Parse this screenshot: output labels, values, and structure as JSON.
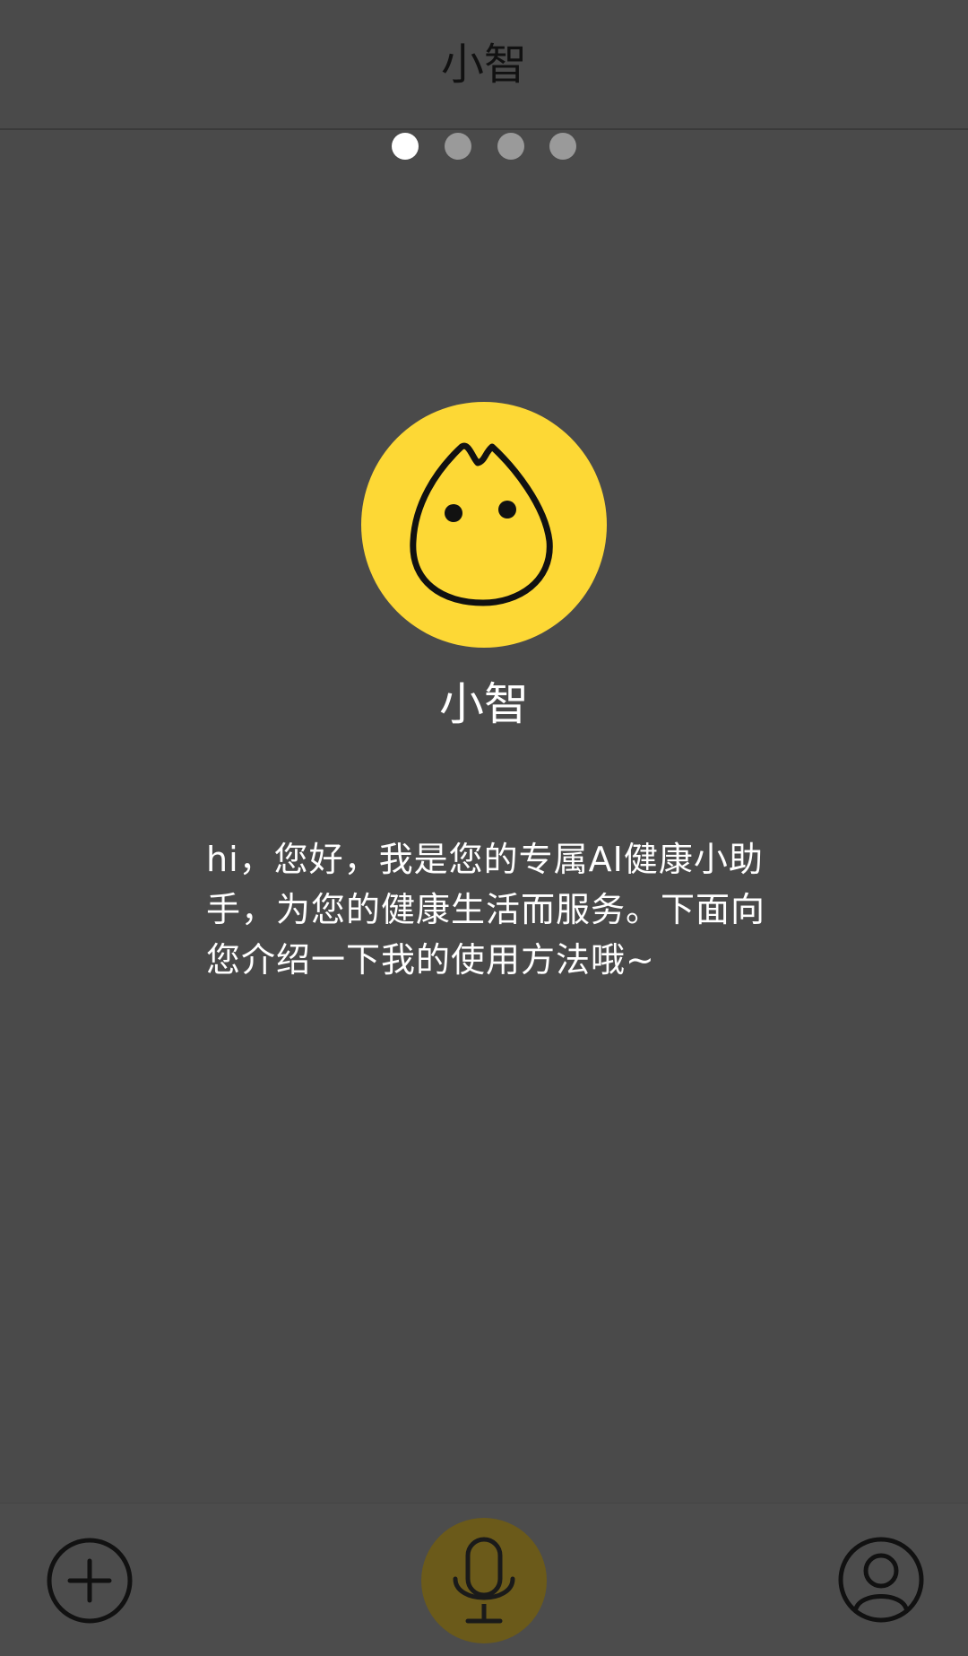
{
  "header": {
    "title": "小智"
  },
  "pager": {
    "total_pages": 4,
    "active_page": 1
  },
  "assistant": {
    "name": "小智",
    "avatar_icon": "cat-face-icon",
    "avatar_color": "#fdd835"
  },
  "intro": {
    "text": "hi，您好，我是您的专属AI健康小助手，为您的健康生活而服务。下面向您介绍一下我的使用方法哦~"
  },
  "bottom_bar": {
    "add_icon": "plus-circle-icon",
    "mic_icon": "microphone-icon",
    "profile_icon": "user-profile-icon",
    "mic_color": "#6b5a1a"
  },
  "colors": {
    "background": "#4a4a4a",
    "accent": "#fdd835"
  }
}
